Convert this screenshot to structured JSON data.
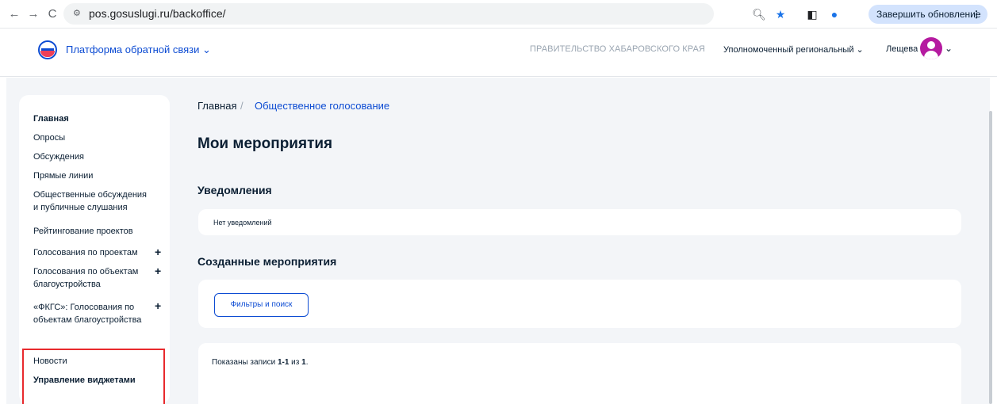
{
  "browser": {
    "back_icon": "←",
    "forward_icon": "→",
    "reload_icon": "C",
    "url": "pos.gosuslugi.ru/backoffice/",
    "update_label": "Завершить обновление"
  },
  "header": {
    "platform_title": "Платформа обратной связи",
    "government": "ПРАВИТЕЛЬСТВО ХАБАРОВСКОГО КРАЯ",
    "role": "Уполномоченный региональный",
    "user_name": "Лещева Е."
  },
  "sidebar": {
    "items": [
      {
        "label": "Главная"
      },
      {
        "label": "Опросы"
      },
      {
        "label": "Обсуждения"
      },
      {
        "label": "Прямые линии"
      },
      {
        "label": "Общественные обсуждения и публичные слушания"
      },
      {
        "label": "Рейтингование проектов"
      },
      {
        "label": "Голосования по проектам"
      },
      {
        "label": "Голосования по объектам благоустройства"
      },
      {
        "label": "«ФКГС»: Голосования по объектам благоустройства"
      },
      {
        "label": "Новости"
      },
      {
        "label": "Управление виджетами"
      }
    ],
    "plus": "+"
  },
  "breadcrumb": {
    "home": "Главная",
    "separator": "/",
    "current": "Общественное голосование"
  },
  "main": {
    "title": "Мои мероприятия",
    "notifications_title": "Уведомления",
    "notifications_empty": "Нет уведомлений",
    "created_title": "Созданные мероприятия",
    "filters_button": "Фильтры и поиск",
    "records_prefix": "Показаны записи ",
    "records_range": "1-1",
    "records_mid": " из ",
    "records_total": "1",
    "records_suffix": "."
  },
  "colors": {
    "accent": "#0d4cd3",
    "highlight": "#e8292d",
    "avatar": "#b51aa0"
  }
}
